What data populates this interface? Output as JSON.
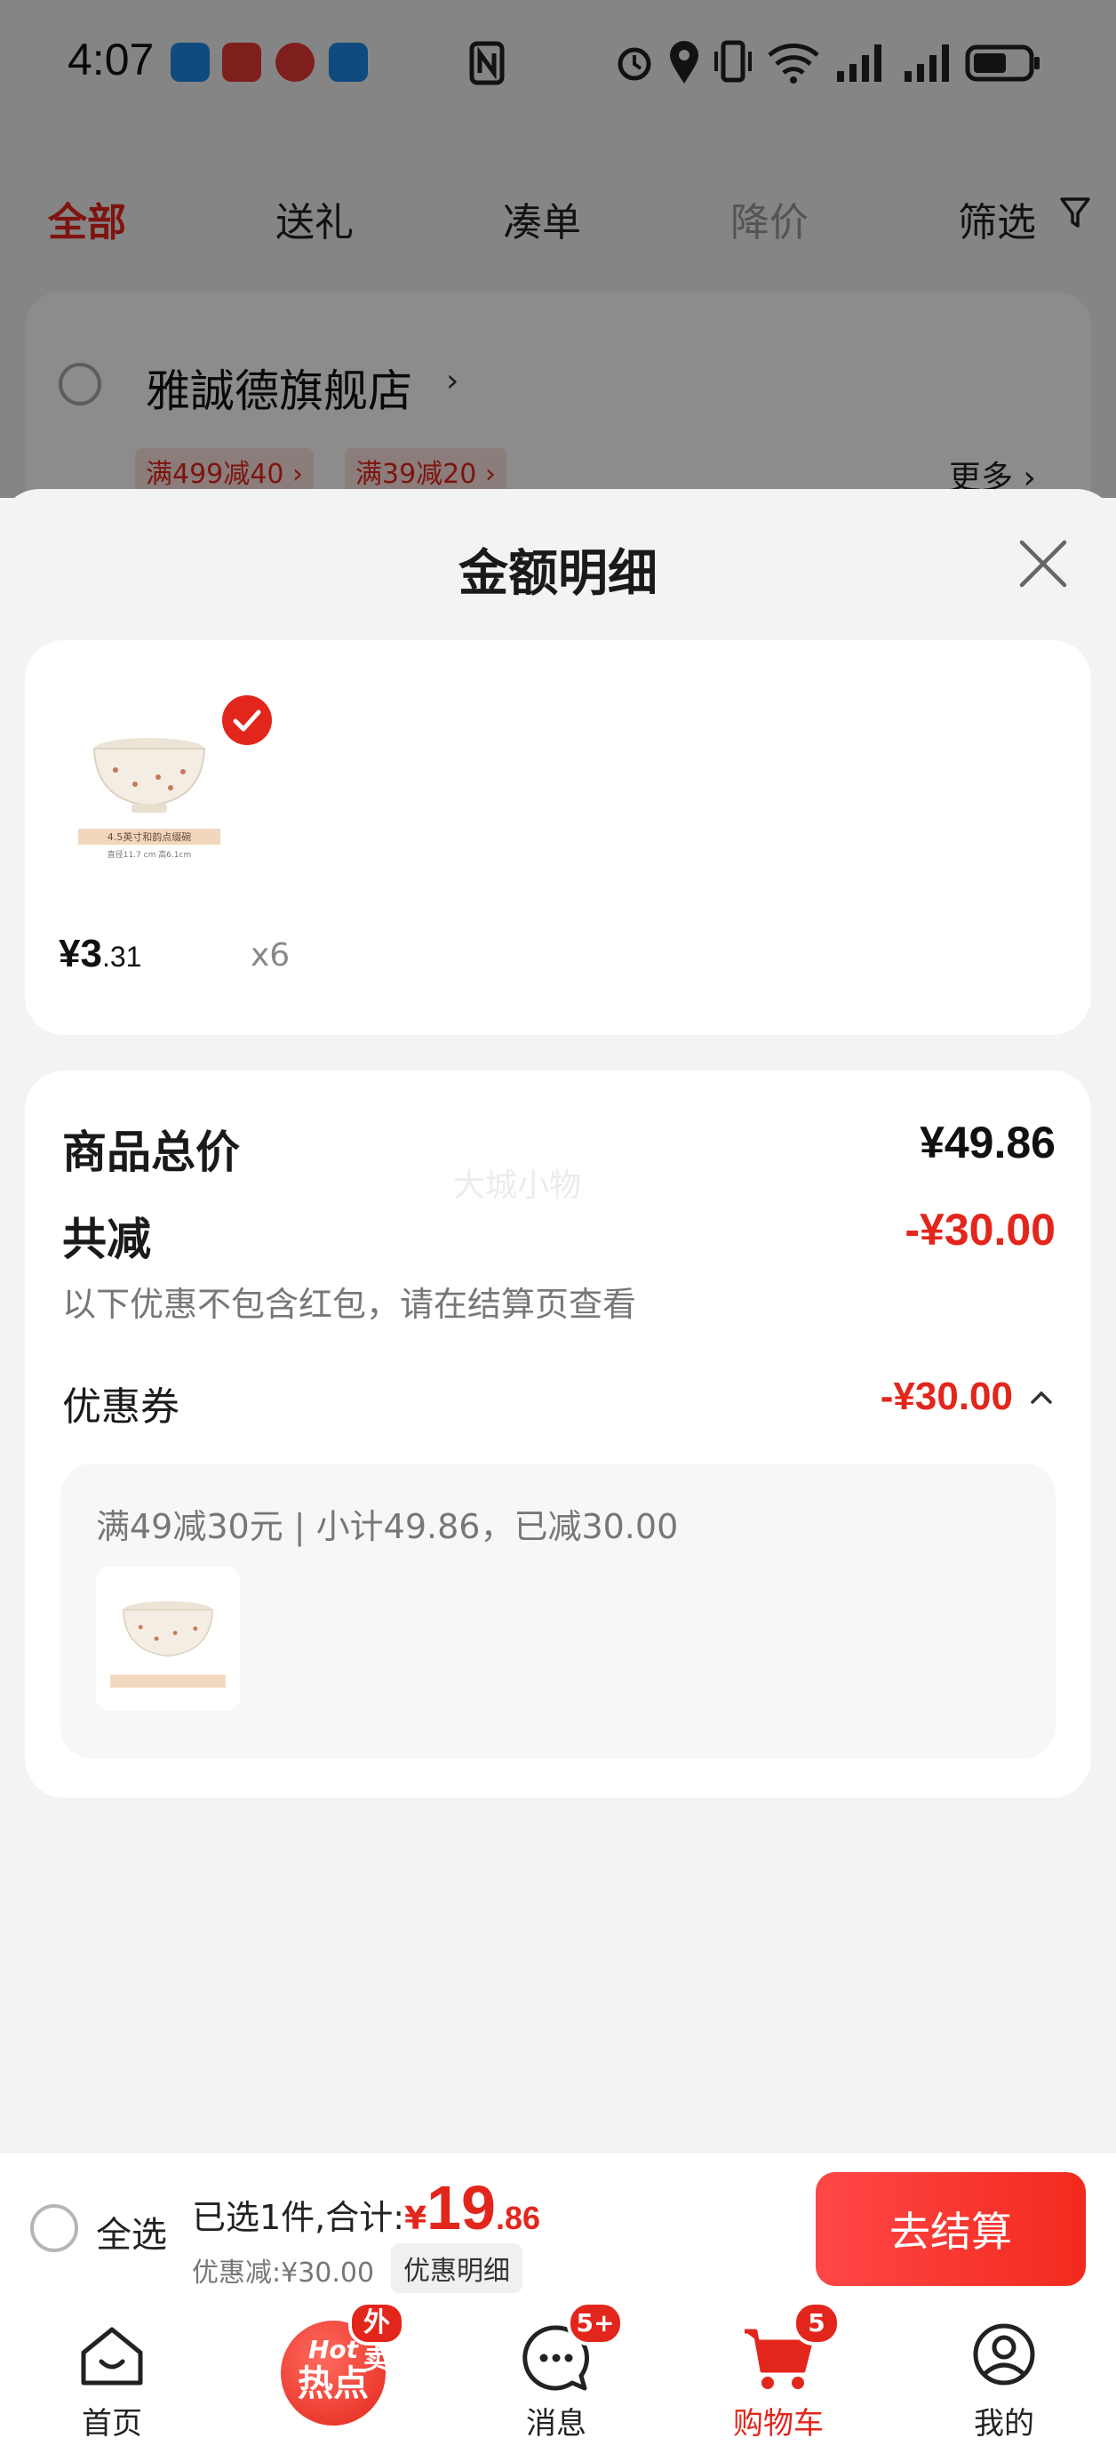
{
  "status_bar": {
    "time": "4:07"
  },
  "filter_tabs": [
    {
      "label": "全部"
    },
    {
      "label": "送礼"
    },
    {
      "label": "凑单"
    },
    {
      "label": "降价"
    },
    {
      "label": "筛选"
    }
  ],
  "store": {
    "name": "雅誠德旗舰店",
    "promos": [
      "满499减40 ›",
      "满39减20 ›"
    ],
    "more": "更多 ›"
  },
  "sheet": {
    "title": "金额明细",
    "item": {
      "price_int": "¥3",
      "price_dec": ".31",
      "qty": "x6",
      "thumb_caption": "4.5英寸和韵点缀碗",
      "thumb_sub": "直径11.7 cm 高6.1cm"
    },
    "summary": {
      "goods_total_label": "商品总价",
      "goods_total_value": "¥49.86",
      "watermark": "大城小物",
      "reduce_label": "共减",
      "reduce_value": "-¥30.00",
      "reduce_note": "以下优惠不包含红包，请在结算页查看",
      "coupon_label": "优惠券",
      "coupon_value": "-¥30.00",
      "coupon_detail": "满49减30元 | 小计49.86，已减30.00"
    }
  },
  "checkout": {
    "select_all": "全选",
    "selected_text": "已选1件,合计:",
    "currency": "¥",
    "total_int": "19",
    "total_dec": ".86",
    "discount_text": "优惠减:¥30.00",
    "detail_link": "优惠明细",
    "checkout_button": "去结算"
  },
  "bottom_nav": [
    {
      "label": "首页"
    },
    {
      "label": "",
      "hot_top": "Hot",
      "hot_main": "热点",
      "badge": "外卖"
    },
    {
      "label": "消息",
      "badge": "5+"
    },
    {
      "label": "购物车",
      "badge": "5"
    },
    {
      "label": "我的"
    }
  ],
  "colors": {
    "accent": "#e3261c",
    "text": "#1a1a1a",
    "muted": "#777777"
  }
}
